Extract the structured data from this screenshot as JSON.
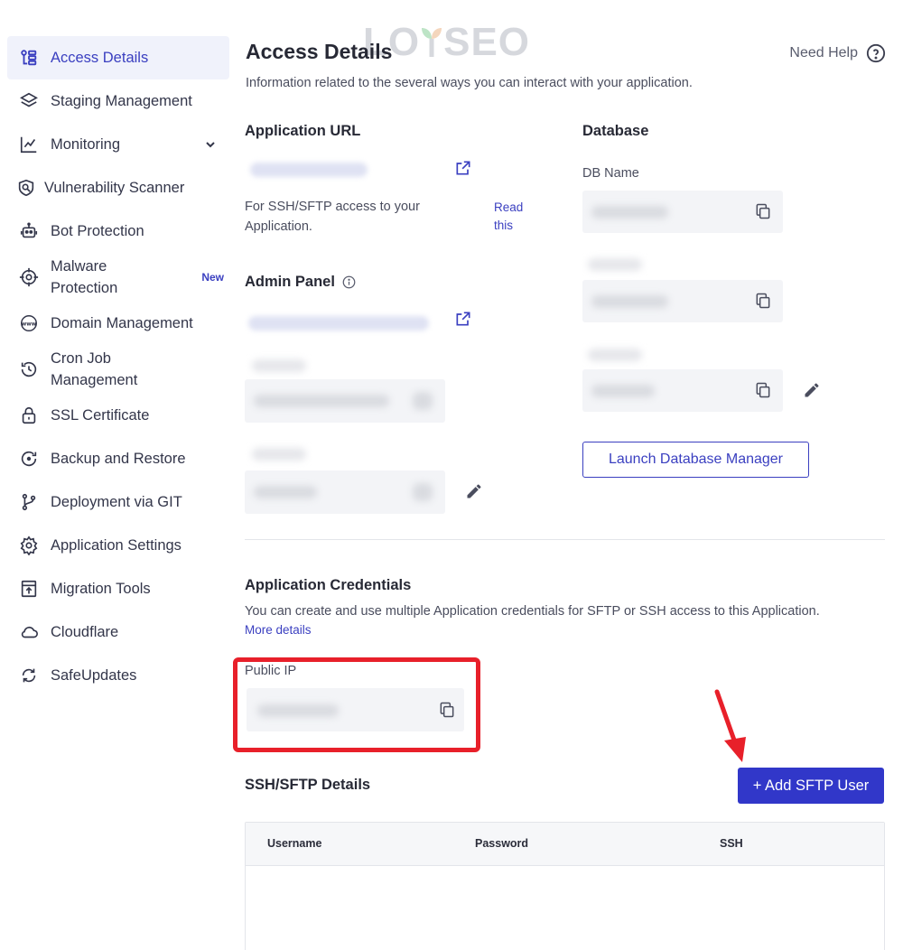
{
  "sidebar": {
    "items": [
      {
        "label": "Access Details",
        "icon": "access-details-icon",
        "active": true
      },
      {
        "label": "Staging Management",
        "icon": "layers-icon"
      },
      {
        "label": "Monitoring",
        "icon": "chart-line-icon",
        "expandable": true
      },
      {
        "label": "Vulnerability Scanner",
        "icon": "shield-scan-icon"
      },
      {
        "label": "Bot Protection",
        "icon": "robot-icon"
      },
      {
        "label": "Malware Protection",
        "icon": "target-icon",
        "badge": "New"
      },
      {
        "label": "Domain Management",
        "icon": "www-icon"
      },
      {
        "label": "Cron Job Management",
        "icon": "clock-history-icon"
      },
      {
        "label": "SSL Certificate",
        "icon": "lock-icon"
      },
      {
        "label": "Backup and Restore",
        "icon": "backup-icon"
      },
      {
        "label": "Deployment via GIT",
        "icon": "git-branch-icon"
      },
      {
        "label": "Application Settings",
        "icon": "gear-icon"
      },
      {
        "label": "Migration Tools",
        "icon": "migration-icon"
      },
      {
        "label": "Cloudflare",
        "icon": "cloud-icon"
      },
      {
        "label": "SafeUpdates",
        "icon": "refresh-icon"
      }
    ]
  },
  "header": {
    "title": "Access Details",
    "subtitle": "Information related to the several ways you can interact with your application.",
    "help": "Need Help"
  },
  "watermark": {
    "left": "LO",
    "right": "SEO"
  },
  "app_url": {
    "title": "Application URL",
    "ssh_hint": "For SSH/SFTP access to your Application.",
    "ssh_hint_line1": "For SSH/SFTP access to your",
    "ssh_hint_line2": "Application.",
    "read_this_1": "Read",
    "read_this_2": "this"
  },
  "admin_panel": {
    "title": "Admin Panel"
  },
  "database": {
    "title": "Database",
    "db_name_label": "DB Name",
    "launch_button": "Launch Database Manager"
  },
  "credentials": {
    "title": "Application Credentials",
    "description": "You can create and use multiple Application credentials for SFTP or SSH access to this Application.",
    "more_details": "More details",
    "public_ip_label": "Public IP"
  },
  "sftp": {
    "title": "SSH/SFTP Details",
    "add_button": "+ Add SFTP User",
    "columns": [
      "Username",
      "Password",
      "SSH"
    ]
  },
  "colors": {
    "accent": "#3137c9",
    "highlight": "#e8202a"
  }
}
